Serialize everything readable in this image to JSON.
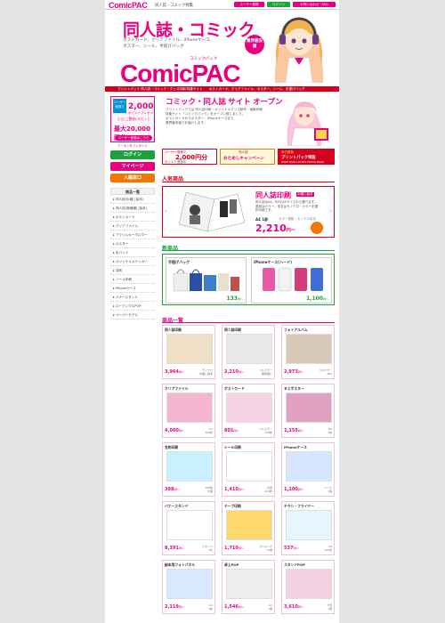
{
  "header": {
    "logo": "ComicPAC",
    "tagline": "同人誌・コミック特集",
    "buttons": [
      "ユーザー登録",
      "ログイン",
      "お問い合わせ・FAQ"
    ]
  },
  "hero": {
    "title": "同人誌・コミック",
    "subtitle_lines": [
      "ポストカード、クリアファイル、iPhoneケース、",
      "ポスター、シール、手提げバッグ"
    ],
    "badge": "業界最安値",
    "logo_kana": "コミックパック",
    "logo": "ComicPAC"
  },
  "category_bar": "プリントパック 同人誌・コミック・グッズ印刷 特集サイト　　ポストカード、クリアファイル、ポスター、シール、手提げバッグ",
  "sidebar": {
    "promo": {
      "tag": "ユーザー登録で",
      "points": "2,000",
      "points_unit": "ポイントプレゼント",
      "note": "さらにご登録いただくと",
      "coupon": "最大20,000円分",
      "coupon_label": "クーポンをプレゼント",
      "button": "ユーザー登録はこちら"
    },
    "buttons": [
      {
        "label": "ログイン",
        "color": "#1aa33b"
      },
      {
        "label": "マイページ",
        "color": "#e8007d"
      },
      {
        "label": "入稿窓口",
        "color": "#f07800"
      }
    ],
    "list_title": "商品一覧",
    "items": [
      "同人誌(中綴じ製本)",
      "同人誌(無線綴じ製本)",
      "ポストカード",
      "クリアファイル",
      "アクリルキーホルダー",
      "ポスター",
      "缶バッジ",
      "オリジナルステッカー",
      "名刺",
      "シール印刷",
      "iPhoneケース",
      "バナースタンド",
      "ローアングルPOP",
      "ペーパーモデル"
    ]
  },
  "main": {
    "open_title": "コミック・同人誌 サイト オープン",
    "open_desc": [
      "プリントパックでは 同人誌印刷・オリジナルグッズ制作・画集印刷",
      "特集サイト「コミックパック」をオープン致しました。",
      "ポストカードからポスター、iPhoneケースまで",
      "業界最安値でお届けします。"
    ],
    "banners": [
      {
        "small": "ユーザー登録で",
        "big": "2,000円分",
        "sub": "ポイント進呈中"
      },
      {
        "small": "同人誌",
        "big": "おためしキャンペーン",
        "sub": ""
      },
      {
        "small": "毎日更新",
        "big": "プリントパック特設",
        "sub": "PRINT PACK LOVERS PHOTO BOOK"
      }
    ],
    "popular": {
      "title": "人気商品",
      "product": "同人誌印刷",
      "product_tag": "中綴じ製本",
      "desc": "同人誌はA4、B5やA5サイズから選べます。表紙はカラー、本文はモノクロ・カラーを選択可能です。",
      "spec": "A4 1部",
      "price": "2,210",
      "price_unit": "円〜",
      "note": "カラー表紙・モノクロ本文"
    },
    "new_arrivals": {
      "title": "新商品",
      "items": [
        {
          "name": "手提げバッグ",
          "price": "133",
          "unit": "円〜"
        },
        {
          "name": "iPhoneケース(ハード)",
          "price": "1,100",
          "unit": "円〜"
        }
      ]
    },
    "catalog_title": "商品一覧",
    "catalog": [
      {
        "name": "同人誌印刷",
        "price": "3,964",
        "unit": "円〜",
        "note": "モノクロ\n中綴じ製本"
      },
      {
        "name": "同人誌印刷",
        "price": "2,210",
        "unit": "円〜",
        "note": "フルカラー\n無線綴じ"
      },
      {
        "name": "フォトアルバム",
        "price": "2,973",
        "unit": "円〜",
        "note": "フルカラー\n20P"
      },
      {
        "name": "クリアファイル",
        "price": "4,000",
        "unit": "円〜",
        "note": "A4\n100枚"
      },
      {
        "name": "ポストカード",
        "price": "801",
        "unit": "円〜",
        "note": "フルカラー\n100枚"
      },
      {
        "name": "Ｂ２ポスター",
        "price": "1,155",
        "unit": "円〜",
        "note": "B2\n1枚"
      },
      {
        "name": "名刺印刷",
        "price": "398",
        "unit": "円〜",
        "note": "100枚\n片面"
      },
      {
        "name": "シール印刷",
        "price": "1,410",
        "unit": "円〜",
        "note": "丸型\n100枚"
      },
      {
        "name": "iPhoneケース",
        "price": "1,100",
        "unit": "円〜",
        "note": "ハード\n1個"
      },
      {
        "name": "バナースタンド",
        "price": "8,391",
        "unit": "円〜",
        "note": "スタンド\n1台"
      },
      {
        "name": "テープ印刷",
        "price": "1,710",
        "unit": "円〜",
        "note": "マスキング\n10巻"
      },
      {
        "name": "チラシ・フライヤー",
        "price": "537",
        "unit": "円〜",
        "note": "A4\n100枚"
      },
      {
        "name": "絵本用フォトパネル",
        "price": "2,119",
        "unit": "円〜",
        "note": "A4\n1枚"
      },
      {
        "name": "卓上POP",
        "price": "1,546",
        "unit": "円〜",
        "note": "A4\n1個"
      },
      {
        "name": "スタンドPOP",
        "price": "3,610",
        "unit": "円〜",
        "note": "大型\n1個"
      }
    ]
  },
  "colors": {
    "accent": "#e8007d",
    "red": "#d4001d",
    "green": "#1aa33b",
    "orange": "#f07800",
    "blue": "#0092d8"
  }
}
